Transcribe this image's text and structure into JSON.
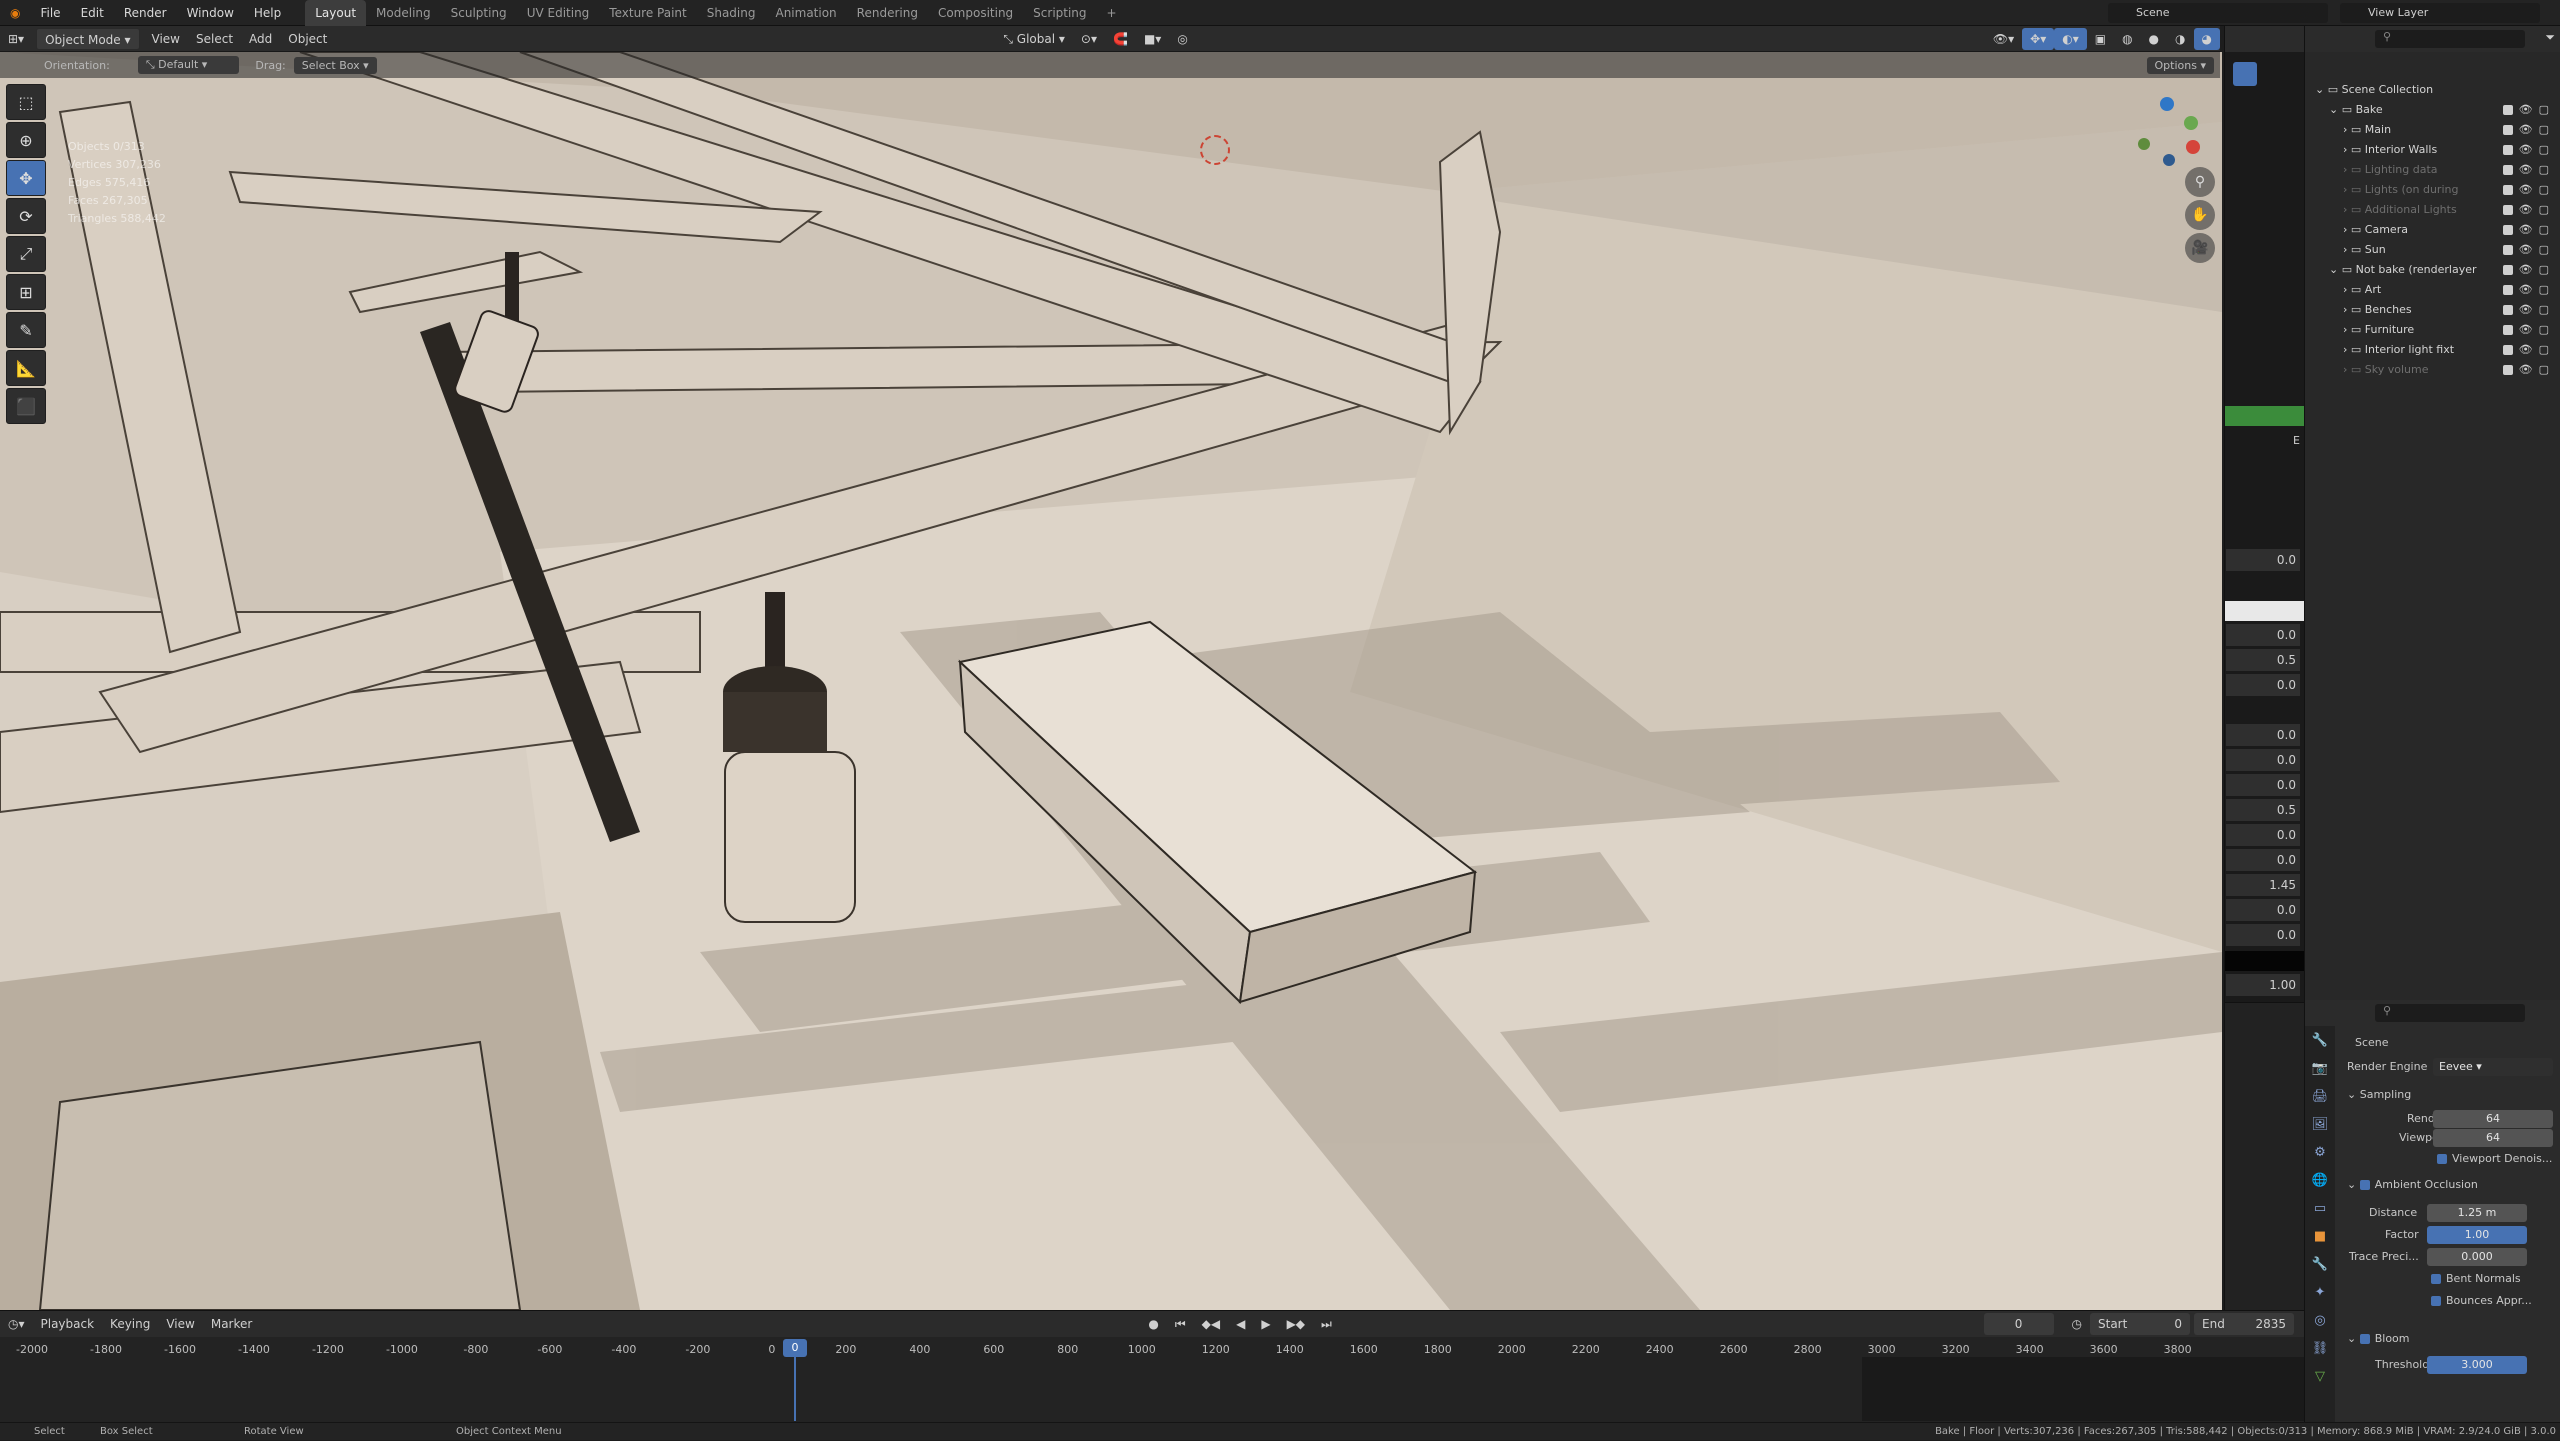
{
  "topbar": {
    "menus": [
      "File",
      "Edit",
      "Render",
      "Window",
      "Help"
    ],
    "workspaces": [
      "Layout",
      "Modeling",
      "Sculpting",
      "UV Editing",
      "Texture Paint",
      "Shading",
      "Animation",
      "Rendering",
      "Compositing",
      "Scripting"
    ],
    "active_workspace": "Layout",
    "add_tab": "+",
    "scene_label": "Scene",
    "view_layer_label": "View Layer"
  },
  "header": {
    "mode": "Object Mode",
    "menus": [
      "View",
      "Select",
      "Add",
      "Object"
    ],
    "transform_orientation": "Global",
    "options": "Options"
  },
  "tool_settings": {
    "orientation_label": "Orientation:",
    "orientation_value": "Default",
    "drag_label": "Drag:",
    "drag_value": "Select Box"
  },
  "viewport_stats": [
    "Objects  0/313",
    "Vertices  307,236",
    "Edges  575,416",
    "Faces  267,305",
    "Triangles  588,442"
  ],
  "midcol_values": [
    "0.0",
    "0.0",
    "0.5",
    "0.0",
    "0.0",
    "0.0",
    "0.0",
    "0.5",
    "0.0",
    "0.0",
    "1.45",
    "0.0",
    "0.0",
    "1.00"
  ],
  "midcol_letter": "E",
  "outliner": {
    "search_placeholder": "",
    "items": [
      {
        "label": "Scene Collection",
        "indent": 0,
        "dim": false
      },
      {
        "label": "Bake",
        "indent": 1,
        "dim": false
      },
      {
        "label": "Main",
        "indent": 2,
        "dim": false
      },
      {
        "label": "Interior Walls",
        "indent": 2,
        "dim": false
      },
      {
        "label": "Lighting data",
        "indent": 2,
        "dim": true
      },
      {
        "label": "Lights (on during",
        "indent": 2,
        "dim": true
      },
      {
        "label": "Additional Lights",
        "indent": 2,
        "dim": true
      },
      {
        "label": "Camera",
        "indent": 2,
        "dim": false
      },
      {
        "label": "Sun",
        "indent": 2,
        "dim": false
      },
      {
        "label": "Not bake (renderlayer",
        "indent": 1,
        "dim": false
      },
      {
        "label": "Art",
        "indent": 2,
        "dim": false
      },
      {
        "label": "Benches",
        "indent": 2,
        "dim": false
      },
      {
        "label": "Furniture",
        "indent": 2,
        "dim": false
      },
      {
        "label": "Interior light fixt",
        "indent": 2,
        "dim": false
      },
      {
        "label": "Sky volume",
        "indent": 2,
        "dim": true
      }
    ]
  },
  "properties": {
    "context": "Scene",
    "render_engine_label": "Render Engine",
    "render_engine_value": "Eevee",
    "sampling": {
      "title": "Sampling",
      "render_label": "Render",
      "render_value": "64",
      "viewport_label": "Viewport",
      "viewport_value": "64",
      "denoise_label": "Viewport Denois..."
    },
    "ambient_occlusion": {
      "title": "Ambient Occlusion",
      "distance_label": "Distance",
      "distance_value": "1.25 m",
      "factor_label": "Factor",
      "factor_value": "1.00",
      "trace_label": "Trace Preci...",
      "trace_value": "0.000",
      "bent_normals": "Bent Normals",
      "bounces": "Bounces Appr..."
    },
    "bloom": {
      "title": "Bloom",
      "threshold_label": "Threshold",
      "threshold_value": "3.000"
    }
  },
  "timeline": {
    "menus": [
      "Playback",
      "Keying",
      "View",
      "Marker"
    ],
    "current_frame": "0",
    "frame_field": "0",
    "start_label": "Start",
    "start_value": "0",
    "end_label": "End",
    "end_value": "2835",
    "ticks": [
      "-2000",
      "-1800",
      "-1600",
      "-1400",
      "-1200",
      "-1000",
      "-800",
      "-600",
      "-400",
      "-200",
      "0",
      "200",
      "400",
      "600",
      "800",
      "1000",
      "1200",
      "1400",
      "1600",
      "1800",
      "2000",
      "2200",
      "2400",
      "2600",
      "2800",
      "3000",
      "3200",
      "3400",
      "3600",
      "3800"
    ]
  },
  "statusbar": {
    "select": "Select",
    "box_select": "Box Select",
    "rotate_view": "Rotate View",
    "context_menu": "Object Context Menu",
    "info": "Bake | Floor | Verts:307,236 | Faces:267,305 | Tris:588,442 | Objects:0/313 | Memory: 868.9 MiB | VRAM: 2.9/24.0 GiB | 3.0.0"
  }
}
